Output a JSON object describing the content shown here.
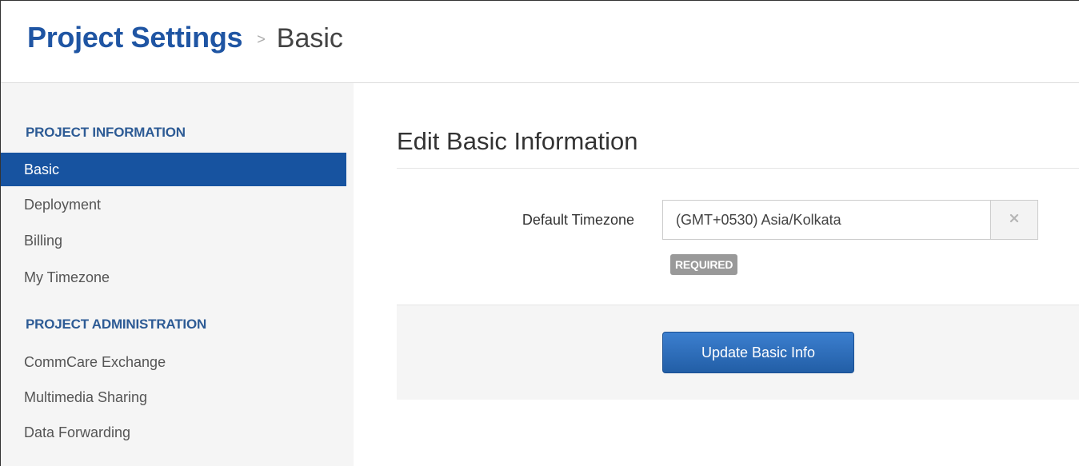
{
  "header": {
    "title": "Project Settings",
    "separator": ">",
    "current": "Basic"
  },
  "sidebar": {
    "sections": [
      {
        "heading": "PROJECT INFORMATION",
        "items": [
          {
            "label": "Basic",
            "active": true
          },
          {
            "label": "Deployment",
            "active": false
          },
          {
            "label": "Billing",
            "active": false
          },
          {
            "label": "My Timezone",
            "active": false
          }
        ]
      },
      {
        "heading": "PROJECT ADMINISTRATION",
        "items": [
          {
            "label": "CommCare Exchange",
            "active": false
          },
          {
            "label": "Multimedia Sharing",
            "active": false
          },
          {
            "label": "Data Forwarding",
            "active": false
          }
        ]
      }
    ]
  },
  "main": {
    "title": "Edit Basic Information",
    "timezone_field": {
      "label": "Default Timezone",
      "value": "(GMT+0530) Asia/Kolkata",
      "clear_icon": "close-icon",
      "badge": "REQUIRED"
    },
    "submit_label": "Update Basic Info"
  },
  "colors": {
    "brand_blue": "#1f55a3",
    "active_nav": "#1753a0",
    "button_blue": "#2b6bb8",
    "badge_gray": "#999999"
  }
}
